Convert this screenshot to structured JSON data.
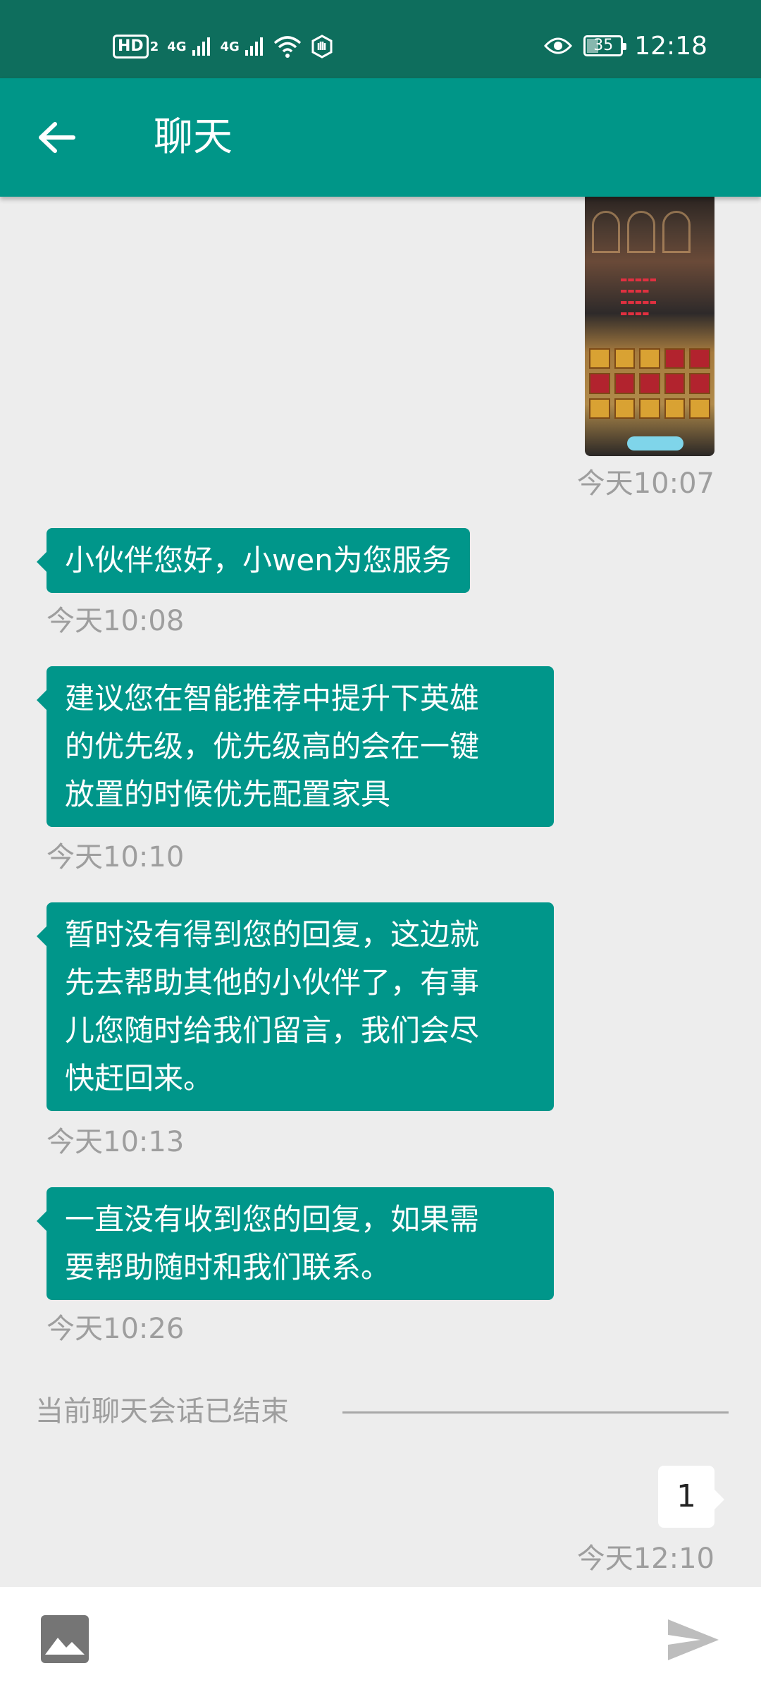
{
  "status_bar": {
    "hd": "HD",
    "sim": "2",
    "net1": "4G",
    "net2": "4G",
    "battery": "35",
    "time": "12:18"
  },
  "app_bar": {
    "title": "聊天",
    "back_icon": "arrow-left-icon"
  },
  "messages": [
    {
      "side": "right",
      "type": "image",
      "time": "今天10:07"
    },
    {
      "side": "left",
      "text": "小伙伴您好，小wen为您服务",
      "time": "今天10:08"
    },
    {
      "side": "left",
      "lines": [
        "建议您在智能推荐中提升下英雄",
        "的优先级，优先级高的会在一键",
        "放置的时候优先配置家具"
      ],
      "time": "今天10:10"
    },
    {
      "side": "left",
      "lines": [
        "暂时没有得到您的回复，这边就",
        "先去帮助其他的小伙伴了，有事",
        "儿您随时给我们留言，我们会尽",
        "快赶回来。"
      ],
      "time": "今天10:13"
    },
    {
      "side": "left",
      "lines": [
        "一直没有收到您的回复，如果需",
        "要帮助随时和我们联系。"
      ],
      "time": "今天10:26"
    }
  ],
  "session_ended": "当前聊天会话已结束",
  "user_message": {
    "text": "1",
    "time": "今天12:10"
  },
  "input_bar": {
    "image_icon": "image-icon",
    "send_icon": "send-icon"
  },
  "colors": {
    "status_bar": "#0e6e5d",
    "app_bar": "#009688",
    "bubble": "#00968a",
    "background": "#ededed"
  }
}
